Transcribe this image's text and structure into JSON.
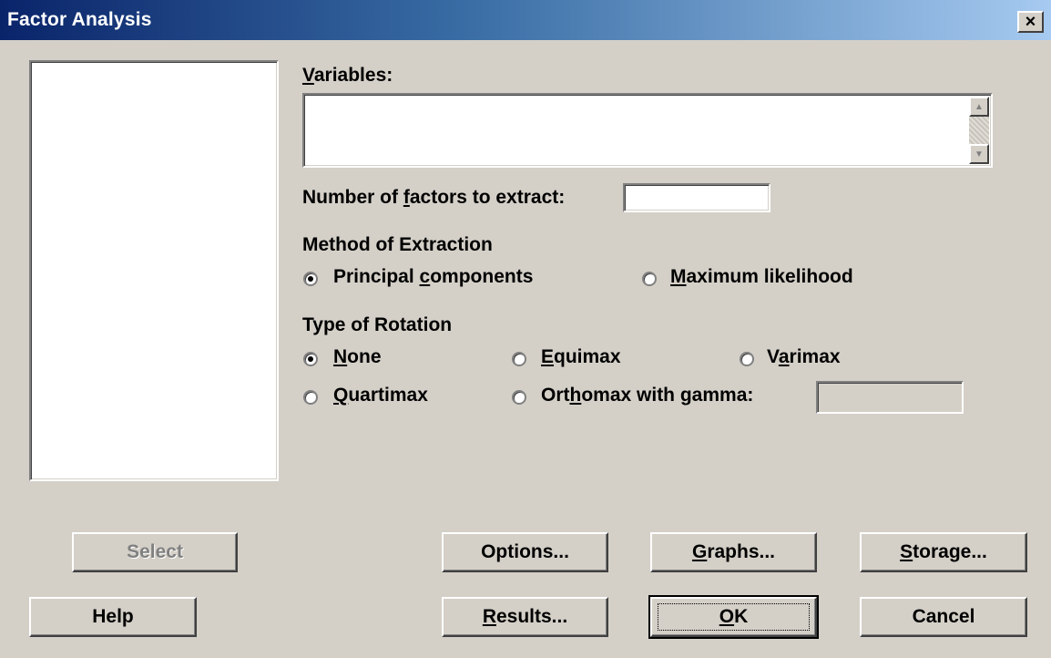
{
  "window": {
    "title": "Factor Analysis",
    "close_symbol": "×"
  },
  "variables": {
    "label_prefix": "",
    "label_key": "V",
    "label_rest": "ariables:",
    "value": ""
  },
  "factors": {
    "label_pre": "Number of ",
    "label_key": "f",
    "label_post": "actors to extract:",
    "value": ""
  },
  "extraction": {
    "heading": "Method of Extraction",
    "options": [
      {
        "pre": "Principal ",
        "key": "c",
        "post": "omponents",
        "selected": true
      },
      {
        "pre": "",
        "key": "M",
        "post": "aximum likelihood",
        "selected": false
      }
    ]
  },
  "rotation": {
    "heading": "Type of Rotation",
    "options": [
      {
        "pre": "",
        "key": "N",
        "post": "one",
        "selected": true
      },
      {
        "pre": "",
        "key": "E",
        "post": "quimax",
        "selected": false
      },
      {
        "pre": "V",
        "key": "a",
        "post": "rimax",
        "selected": false
      },
      {
        "pre": "",
        "key": "Q",
        "post": "uartimax",
        "selected": false
      },
      {
        "pre": "Ort",
        "key": "h",
        "post": "omax with gamma:",
        "selected": false
      }
    ],
    "gamma_value": ""
  },
  "buttons": {
    "select": "Select",
    "help": "Help",
    "options": {
      "pre": "",
      "key": "",
      "post": "Options..."
    },
    "graphs": {
      "pre": "",
      "key": "G",
      "post": "raphs..."
    },
    "storage": {
      "pre": "",
      "key": "S",
      "post": "torage..."
    },
    "results": {
      "pre": "",
      "key": "R",
      "post": "esults..."
    },
    "ok": {
      "pre": "",
      "key": "O",
      "post": "K"
    },
    "cancel": "Cancel"
  },
  "colors": {
    "face": "#d4d0c8",
    "title_start": "#0a246a",
    "title_end": "#a6caf0",
    "disabled_text": "#808080"
  }
}
